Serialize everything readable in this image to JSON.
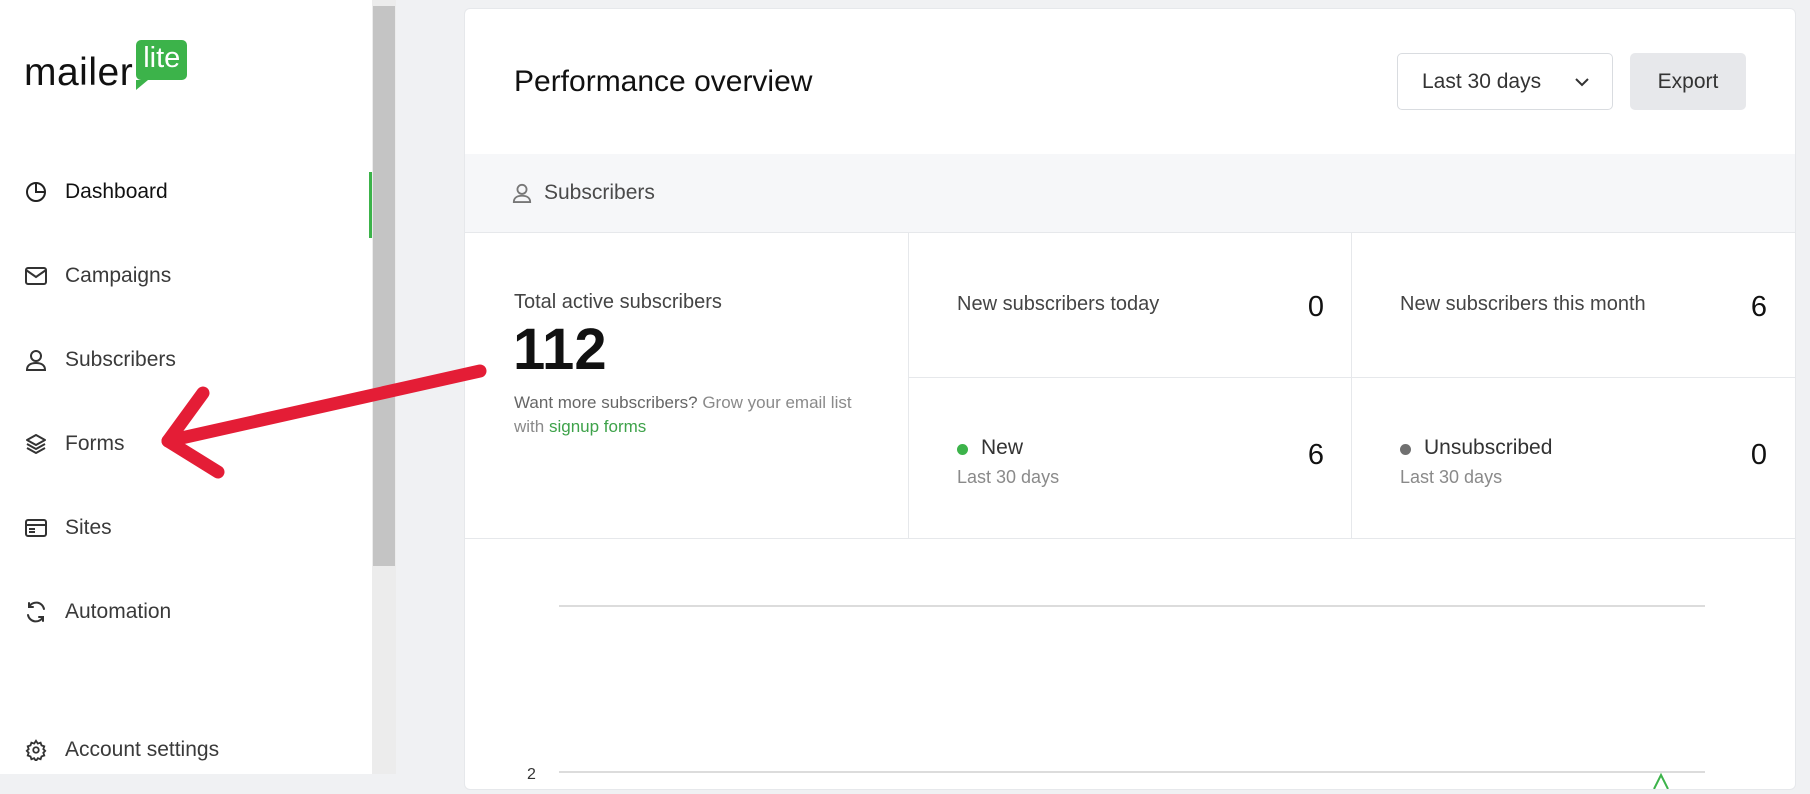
{
  "brand": {
    "name": "mailer",
    "badge": "lite"
  },
  "sidebar": {
    "items": [
      {
        "label": "Dashboard",
        "icon": "pie-chart-icon",
        "active": true
      },
      {
        "label": "Campaigns",
        "icon": "envelope-icon"
      },
      {
        "label": "Subscribers",
        "icon": "user-icon"
      },
      {
        "label": "Forms",
        "icon": "layers-icon"
      },
      {
        "label": "Sites",
        "icon": "browser-window-icon"
      },
      {
        "label": "Automation",
        "icon": "refresh-icon"
      }
    ],
    "settings": {
      "label": "Account settings",
      "icon": "gear-icon"
    }
  },
  "main": {
    "title": "Performance overview",
    "range_label": "Last 30 days",
    "export_label": "Export",
    "section_label": "Subscribers",
    "total": {
      "label": "Total active subscribers",
      "value": "112",
      "hint_dark": "Want more subscribers?",
      "hint_rest": " Grow your email list with ",
      "hint_link": "signup forms"
    },
    "today": {
      "label": "New subscribers today",
      "value": "0"
    },
    "month": {
      "label": "New subscribers this month",
      "value": "6"
    },
    "new": {
      "label": "New",
      "sub": "Last 30 days",
      "value": "6"
    },
    "unsub": {
      "label": "Unsubscribed",
      "sub": "Last 30 days",
      "value": "0"
    }
  },
  "chart": {
    "y_tick": "2"
  },
  "colors": {
    "accent": "#3cb34a",
    "annotation": "#e41d36",
    "unsub_dot": "#707070"
  }
}
